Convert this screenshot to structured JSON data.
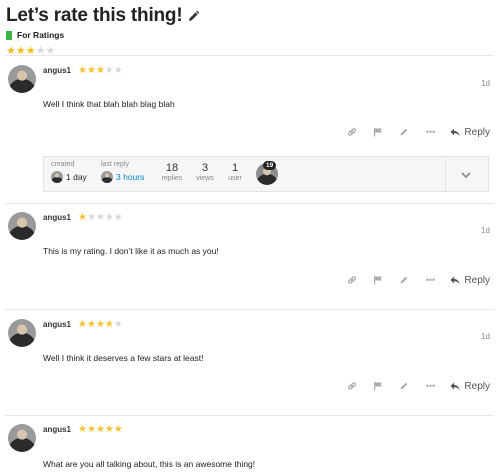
{
  "topic": {
    "title": "Let’s rate this thing!",
    "category": "For Ratings",
    "category_color": "#3ab54a",
    "rating": 3,
    "max_rating": 5
  },
  "posts": [
    {
      "username": "angus1",
      "rating": 3,
      "date": "1d",
      "body": "Well I think that blah blah blag blah"
    },
    {
      "username": "angus1",
      "rating": 1,
      "date": "1d",
      "body": "This is my rating. I don’t like it as much as you!"
    },
    {
      "username": "angus1",
      "rating": 4,
      "date": "1d",
      "body": "Well I think it deserves a few stars at least!"
    },
    {
      "username": "angus1",
      "rating": 5,
      "date": "",
      "body": "What are you all talking about, this is an awesome thing!"
    }
  ],
  "actions": {
    "reply_label": "Reply"
  },
  "topic_map": {
    "created_label": "created",
    "created_value": "1 day",
    "last_reply_label": "last reply",
    "last_reply_value": "3 hours",
    "replies_count": "18",
    "replies_label": "replies",
    "views_count": "3",
    "views_label": "views",
    "users_count": "1",
    "users_label": "user",
    "poster_badge": "19"
  },
  "colors": {
    "star_on": "#f4c430",
    "star_off": "#d8d8d8",
    "link": "#0088cc"
  }
}
